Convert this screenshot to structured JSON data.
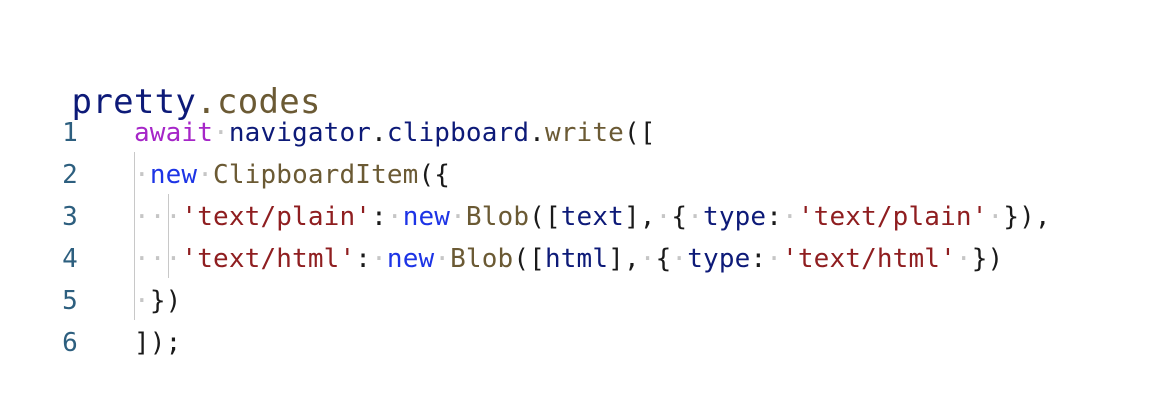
{
  "colors": {
    "keyword": "#a626c8",
    "identifier": "#0d1a78",
    "method": "#6b5a34",
    "keyword_new": "#1d34e6",
    "string": "#8f1e20",
    "punctuation": "#1a1a1a",
    "line_number": "#2d5f7f",
    "whitespace_dot": "#c6c6c6",
    "guide": "#c8c8c8"
  },
  "brand": {
    "part1": "pretty",
    "part2": ".codes",
    "color1": "#0d1a78",
    "color2": "#6b5a34"
  },
  "code": {
    "lines": [
      {
        "number": "1",
        "tokens": [
          {
            "text": "await",
            "kind": "keyword"
          },
          {
            "text": "·",
            "kind": "ws"
          },
          {
            "text": "navigator",
            "kind": "identifier"
          },
          {
            "text": ".",
            "kind": "punctuation"
          },
          {
            "text": "clipboard",
            "kind": "identifier"
          },
          {
            "text": ".",
            "kind": "punctuation"
          },
          {
            "text": "write",
            "kind": "method"
          },
          {
            "text": "([",
            "kind": "punctuation"
          }
        ]
      },
      {
        "number": "2",
        "tokens": [
          {
            "text": "·",
            "kind": "ws"
          },
          {
            "text": "new",
            "kind": "keyword_new"
          },
          {
            "text": "·",
            "kind": "ws"
          },
          {
            "text": "ClipboardItem",
            "kind": "method"
          },
          {
            "text": "({",
            "kind": "punctuation"
          }
        ]
      },
      {
        "number": "3",
        "tokens": [
          {
            "text": "···",
            "kind": "ws"
          },
          {
            "text": "'text/plain'",
            "kind": "string"
          },
          {
            "text": ":",
            "kind": "punctuation"
          },
          {
            "text": "·",
            "kind": "ws"
          },
          {
            "text": "new",
            "kind": "keyword_new"
          },
          {
            "text": "·",
            "kind": "ws"
          },
          {
            "text": "Blob",
            "kind": "method"
          },
          {
            "text": "([",
            "kind": "punctuation"
          },
          {
            "text": "text",
            "kind": "identifier"
          },
          {
            "text": "],",
            "kind": "punctuation"
          },
          {
            "text": "·",
            "kind": "ws"
          },
          {
            "text": "{",
            "kind": "punctuation"
          },
          {
            "text": "·",
            "kind": "ws"
          },
          {
            "text": "type",
            "kind": "identifier"
          },
          {
            "text": ":",
            "kind": "punctuation"
          },
          {
            "text": "·",
            "kind": "ws"
          },
          {
            "text": "'text/plain'",
            "kind": "string"
          },
          {
            "text": "·",
            "kind": "ws"
          },
          {
            "text": "}),",
            "kind": "punctuation"
          }
        ]
      },
      {
        "number": "4",
        "tokens": [
          {
            "text": "···",
            "kind": "ws"
          },
          {
            "text": "'text/html'",
            "kind": "string"
          },
          {
            "text": ":",
            "kind": "punctuation"
          },
          {
            "text": "·",
            "kind": "ws"
          },
          {
            "text": "new",
            "kind": "keyword_new"
          },
          {
            "text": "·",
            "kind": "ws"
          },
          {
            "text": "Blob",
            "kind": "method"
          },
          {
            "text": "([",
            "kind": "punctuation"
          },
          {
            "text": "html",
            "kind": "identifier"
          },
          {
            "text": "],",
            "kind": "punctuation"
          },
          {
            "text": "·",
            "kind": "ws"
          },
          {
            "text": "{",
            "kind": "punctuation"
          },
          {
            "text": "·",
            "kind": "ws"
          },
          {
            "text": "type",
            "kind": "identifier"
          },
          {
            "text": ":",
            "kind": "punctuation"
          },
          {
            "text": "·",
            "kind": "ws"
          },
          {
            "text": "'text/html'",
            "kind": "string"
          },
          {
            "text": "·",
            "kind": "ws"
          },
          {
            "text": "})",
            "kind": "punctuation"
          }
        ]
      },
      {
        "number": "5",
        "tokens": [
          {
            "text": "·",
            "kind": "ws"
          },
          {
            "text": "})",
            "kind": "punctuation"
          }
        ]
      },
      {
        "number": "6",
        "tokens": [
          {
            "text": "]);",
            "kind": "punctuation"
          }
        ]
      }
    ]
  }
}
